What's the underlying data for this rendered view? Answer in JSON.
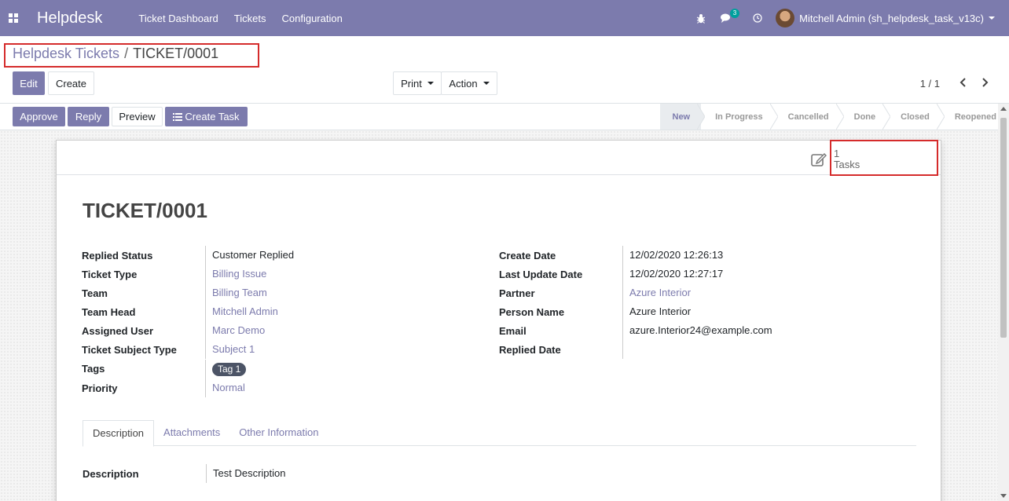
{
  "navbar": {
    "brand": "Helpdesk",
    "menu": [
      "Ticket Dashboard",
      "Tickets",
      "Configuration"
    ],
    "chat_count": "3",
    "user_name": "Mitchell Admin (sh_helpdesk_task_v13c)",
    "icons": [
      "apps-icon",
      "bug-icon",
      "chat-icon",
      "clock-icon"
    ]
  },
  "breadcrumb": {
    "parent": "Helpdesk Tickets",
    "separator": "/",
    "current": "TICKET/0001"
  },
  "control_buttons": {
    "edit": "Edit",
    "create": "Create",
    "print": "Print",
    "action": "Action"
  },
  "pager": {
    "value": "1 / 1"
  },
  "header_buttons": {
    "approve": "Approve",
    "reply": "Reply",
    "preview": "Preview",
    "create_task": "Create Task"
  },
  "stages": [
    "New",
    "In Progress",
    "Cancelled",
    "Done",
    "Closed",
    "Reopened"
  ],
  "active_stage": "New",
  "stat_button": {
    "count": "1",
    "label": "Tasks"
  },
  "ticket": {
    "title": "TICKET/0001",
    "left_fields": [
      {
        "label": "Replied Status",
        "value": "Customer Replied"
      },
      {
        "label": "Ticket Type",
        "value": "Billing Issue"
      },
      {
        "label": "Team",
        "value": "Billing Team"
      },
      {
        "label": "Team Head",
        "value": "Mitchell Admin"
      },
      {
        "label": "Assigned User",
        "value": "Marc Demo"
      },
      {
        "label": "Ticket Subject Type",
        "value": "Subject 1"
      },
      {
        "label": "Tags",
        "value": "Tag 1"
      },
      {
        "label": "Priority",
        "value": "Normal"
      }
    ],
    "right_fields": [
      {
        "label": "Create Date",
        "value": "12/02/2020 12:26:13"
      },
      {
        "label": "Last Update Date",
        "value": "12/02/2020 12:27:17"
      },
      {
        "label": "Partner",
        "value": "Azure Interior"
      },
      {
        "label": "Person Name",
        "value": "Azure Interior"
      },
      {
        "label": "Email",
        "value": "azure.Interior24@example.com"
      },
      {
        "label": "Replied Date",
        "value": ""
      }
    ]
  },
  "tabs": [
    "Description",
    "Attachments",
    "Other Information"
  ],
  "description": {
    "label": "Description",
    "value": "Test Description"
  },
  "colors": {
    "primary": "#7c7bad",
    "highlight": "#d52b2b",
    "badge": "#00a09d"
  }
}
